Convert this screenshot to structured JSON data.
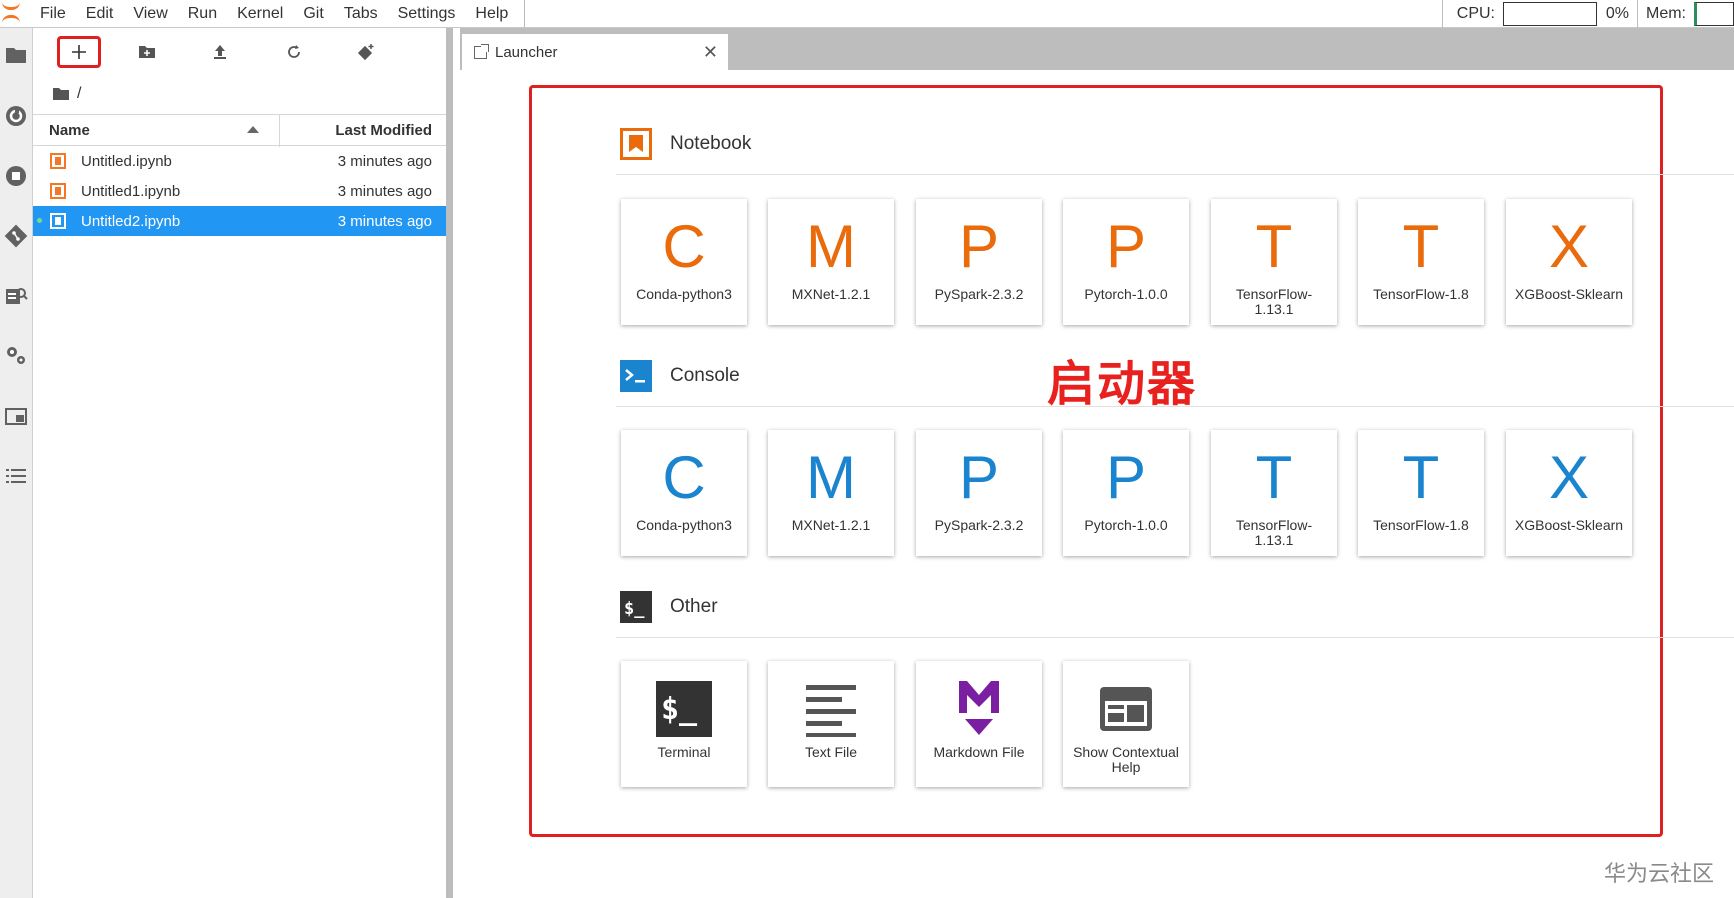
{
  "menubar": {
    "items": [
      "File",
      "Edit",
      "View",
      "Run",
      "Kernel",
      "Git",
      "Tabs",
      "Settings",
      "Help"
    ],
    "cpu_label": "CPU:",
    "cpu_value": "0%",
    "mem_label": "Mem:"
  },
  "activity_bar": {
    "icons": [
      "folder-icon",
      "running-icon",
      "stop-icon",
      "git-icon",
      "commands-icon",
      "settings-icon",
      "tabs-icon",
      "toc-icon"
    ]
  },
  "file_browser": {
    "toolbar": [
      "new-launcher-icon",
      "new-folder-icon",
      "upload-icon",
      "refresh-icon",
      "git-clone-icon"
    ],
    "breadcrumb": "/",
    "columns": {
      "name": "Name",
      "modified": "Last Modified"
    },
    "files": [
      {
        "name": "Untitled.ipynb",
        "modified": "3 minutes ago",
        "selected": false
      },
      {
        "name": "Untitled1.ipynb",
        "modified": "3 minutes ago",
        "selected": false
      },
      {
        "name": "Untitled2.ipynb",
        "modified": "3 minutes ago",
        "selected": true
      }
    ]
  },
  "tab": {
    "label": "Launcher",
    "close": "✕"
  },
  "launcher": {
    "notebook": {
      "title": "Notebook",
      "cards": [
        {
          "letter": "C",
          "label": "Conda-python3"
        },
        {
          "letter": "M",
          "label": "MXNet-1.2.1"
        },
        {
          "letter": "P",
          "label": "PySpark-2.3.2"
        },
        {
          "letter": "P",
          "label": "Pytorch-1.0.0"
        },
        {
          "letter": "T",
          "label": "TensorFlow-1.13.1"
        },
        {
          "letter": "T",
          "label": "TensorFlow-1.8"
        },
        {
          "letter": "X",
          "label": "XGBoost-Sklearn"
        }
      ]
    },
    "console": {
      "title": "Console",
      "cards": [
        {
          "letter": "C",
          "label": "Conda-python3"
        },
        {
          "letter": "M",
          "label": "MXNet-1.2.1"
        },
        {
          "letter": "P",
          "label": "PySpark-2.3.2"
        },
        {
          "letter": "P",
          "label": "Pytorch-1.0.0"
        },
        {
          "letter": "T",
          "label": "TensorFlow-1.13.1"
        },
        {
          "letter": "T",
          "label": "TensorFlow-1.8"
        },
        {
          "letter": "X",
          "label": "XGBoost-Sklearn"
        }
      ]
    },
    "other": {
      "title": "Other",
      "cards": [
        {
          "icon": "terminal-icon",
          "label": "Terminal"
        },
        {
          "icon": "text-file-icon",
          "label": "Text File"
        },
        {
          "icon": "markdown-icon",
          "label": "Markdown File"
        },
        {
          "icon": "contextual-help-icon",
          "label": "Show Contextual Help"
        }
      ]
    }
  },
  "annotation": "启动器",
  "watermark": "华为云社区",
  "colors": {
    "accent": "#2196f3",
    "notebook_orange": "#e96b0c",
    "console_blue": "#1a84cf",
    "highlight_red": "#e02020"
  }
}
